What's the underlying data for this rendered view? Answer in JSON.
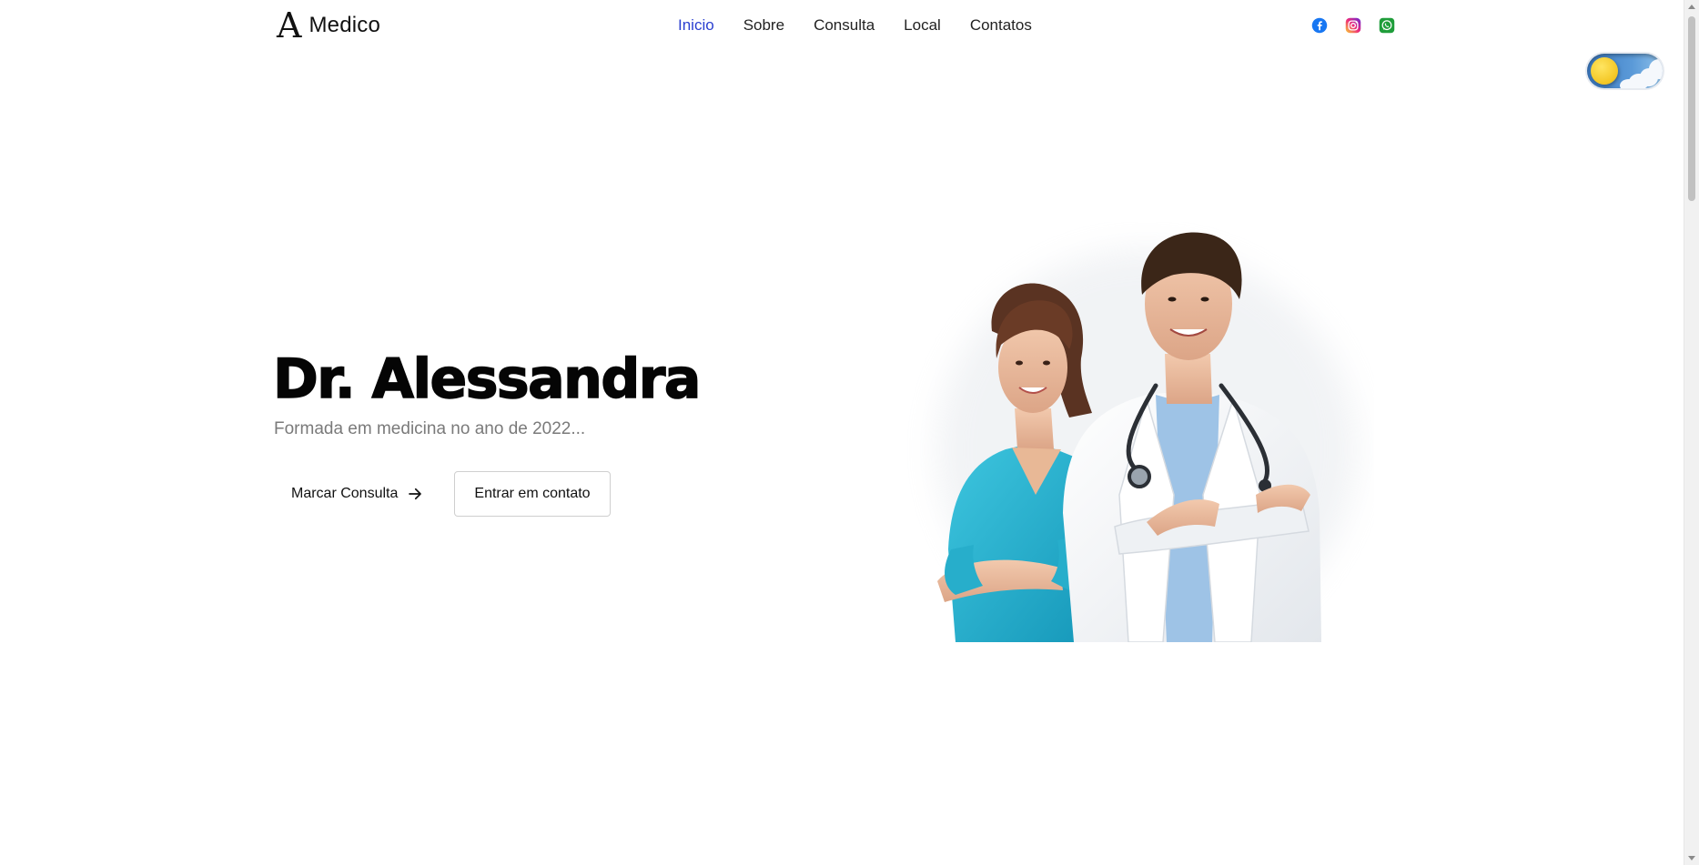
{
  "header": {
    "logo_mark": "A",
    "logo_text": "Medico",
    "nav": [
      {
        "label": "Inicio",
        "active": true
      },
      {
        "label": "Sobre",
        "active": false
      },
      {
        "label": "Consulta",
        "active": false
      },
      {
        "label": "Local",
        "active": false
      },
      {
        "label": "Contatos",
        "active": false
      }
    ],
    "socials": [
      {
        "icon": "facebook-icon",
        "color": "#1877f2"
      },
      {
        "icon": "instagram-icon",
        "color": "#d62976"
      },
      {
        "icon": "whatsapp-icon",
        "color": "#128c3a"
      }
    ],
    "active_color": "#2a3fd0"
  },
  "theme_toggle": {
    "state": "light"
  },
  "hero": {
    "title": "Dr. Alessandra",
    "subtitle": "Formada em medicina no ano de 2022...",
    "primary_button": "Marcar Consulta",
    "secondary_button": "Entrar em contato"
  }
}
